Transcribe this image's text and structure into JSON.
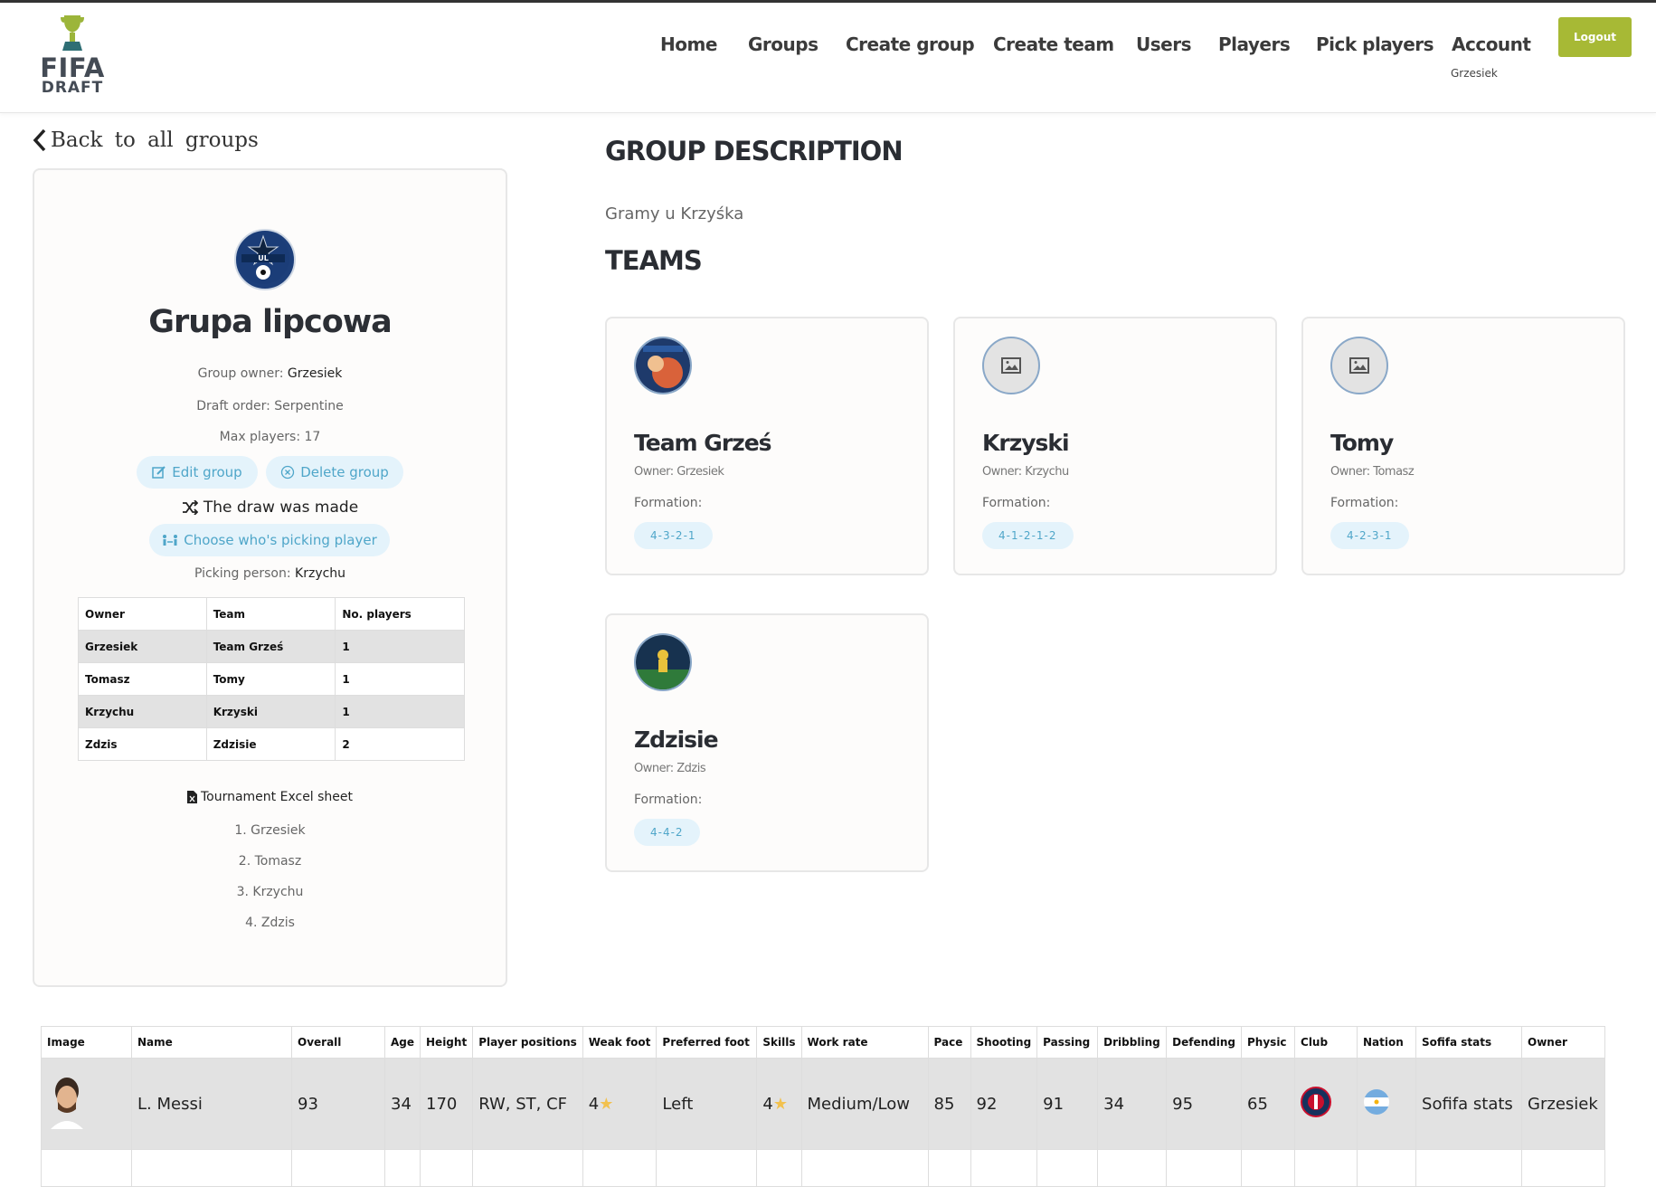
{
  "header": {
    "logo": {
      "line1": "FIFA",
      "line2": "DRAFT"
    },
    "nav": [
      "Home",
      "Groups",
      "Create group",
      "Create team",
      "Users",
      "Players",
      "Pick players",
      "Account"
    ],
    "account_user": "Grzesiek",
    "logout_label": "Logout"
  },
  "back_link": "Back to all groups",
  "group": {
    "name": "Grupa lipcowa",
    "owner_label": "Group owner:",
    "owner": "Grzesiek",
    "draft_order": "Draft order: Serpentine",
    "max_players": "Max players: 17",
    "edit_label": "Edit group",
    "delete_label": "Delete group",
    "draw_status": "The draw was made",
    "choose_picker_label": "Choose who's picking player",
    "picking_label": "Picking person:",
    "picking_person": "Krzychu",
    "owners_table": {
      "headers": [
        "Owner",
        "Team",
        "No. players"
      ],
      "rows": [
        [
          "Grzesiek",
          "Team Grześ",
          "1"
        ],
        [
          "Tomasz",
          "Tomy",
          "1"
        ],
        [
          "Krzychu",
          "Krzyski",
          "1"
        ],
        [
          "Zdzis",
          "Zdzisie",
          "2"
        ]
      ]
    },
    "excel_label": "Tournament Excel sheet",
    "order": [
      "1. Grzesiek",
      "2. Tomasz",
      "3. Krzychu",
      "4. Zdzis"
    ]
  },
  "description": {
    "title": "GROUP DESCRIPTION",
    "text": "Gramy u Krzyśka"
  },
  "teams": {
    "title": "TEAMS",
    "formation_label": "Formation:",
    "items": [
      {
        "name": "Team Grześ",
        "owner": "Owner: Grzesiek",
        "formation": "4-3-2-1"
      },
      {
        "name": "Krzyski",
        "owner": "Owner: Krzychu",
        "formation": "4-1-2-1-2"
      },
      {
        "name": "Tomy",
        "owner": "Owner: Tomasz",
        "formation": "4-2-3-1"
      },
      {
        "name": "Zdzisie",
        "owner": "Owner: Zdzis",
        "formation": "4-4-2"
      }
    ]
  },
  "players_table": {
    "headers": [
      "Image",
      "Name",
      "Overall",
      "Age",
      "Height",
      "Player positions",
      "Weak foot",
      "Preferred foot",
      "Skills",
      "Work rate",
      "Pace",
      "Shooting",
      "Passing",
      "Dribbling",
      "Defending",
      "Physic",
      "Club",
      "Nation",
      "Sofifa stats",
      "Owner"
    ],
    "rows": [
      {
        "name": "L. Messi",
        "overall": "93",
        "age": "34",
        "height": "170",
        "positions": "RW, ST, CF",
        "weak_foot": "4",
        "preferred_foot": "Left",
        "skills": "4",
        "work_rate": "Medium/Low",
        "pace": "85",
        "shooting": "92",
        "passing": "91",
        "dribbling": "34",
        "defending": "95",
        "physic": "65",
        "sofifa": "Sofifa stats",
        "owner": "Grzesiek"
      }
    ]
  }
}
